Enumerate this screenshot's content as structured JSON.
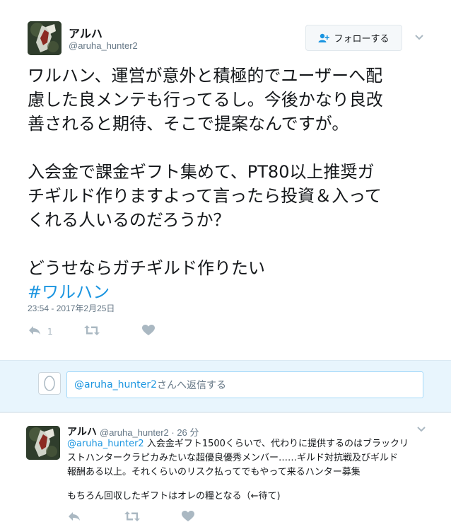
{
  "tweet": {
    "display_name": "アルハ",
    "screen_name": "@aruha_hunter2",
    "follow_label": "フォローする",
    "paragraphs": [
      [
        "ワルハン、運営が意外と積極的でユーザーへ配",
        "慮した良メンテも行ってるし。今後かなり良改",
        "善されると期待、そこで提案なんですが。"
      ],
      [
        "入会金で課金ギフト集めて、PT80以上推奨ガ",
        "チギルド作りますよって言ったら投資＆入って",
        "くれる人いるのだろうか？"
      ],
      [
        "どうせならガチギルド作りたい"
      ]
    ],
    "hashtag": "#ワルハン",
    "timestamp": "23:54 - 2017年2月25日",
    "reply_count": "1",
    "icons": {
      "reply": "reply-icon",
      "retweet": "retweet-icon",
      "like": "heart-icon"
    }
  },
  "reply_box": {
    "mention": "@aruha_hunter2",
    "suffix": "さんへ返信する"
  },
  "reply_tweet": {
    "display_name": "アルハ",
    "meta": "@aruha_hunter2 · 26 分",
    "mention": "@aruha_hunter2",
    "lines": [
      " 入会金ギフト1500くらいで、代わりに提供するのはブラックリ",
      "ストハンタークラピカみたいな超優良優秀メンバー……ギルド対抗戦及びギルド",
      "報酬ある以上。それくらいのリスク払ってでもやって来るハンター募集"
    ],
    "last_line": "もちろん回収したギフトはオレの糧となる（←待て)"
  },
  "colors": {
    "link": "#1b95e0",
    "muted": "#657786",
    "action": "#aab8c2",
    "reply_bg": "#e8f5fd"
  }
}
